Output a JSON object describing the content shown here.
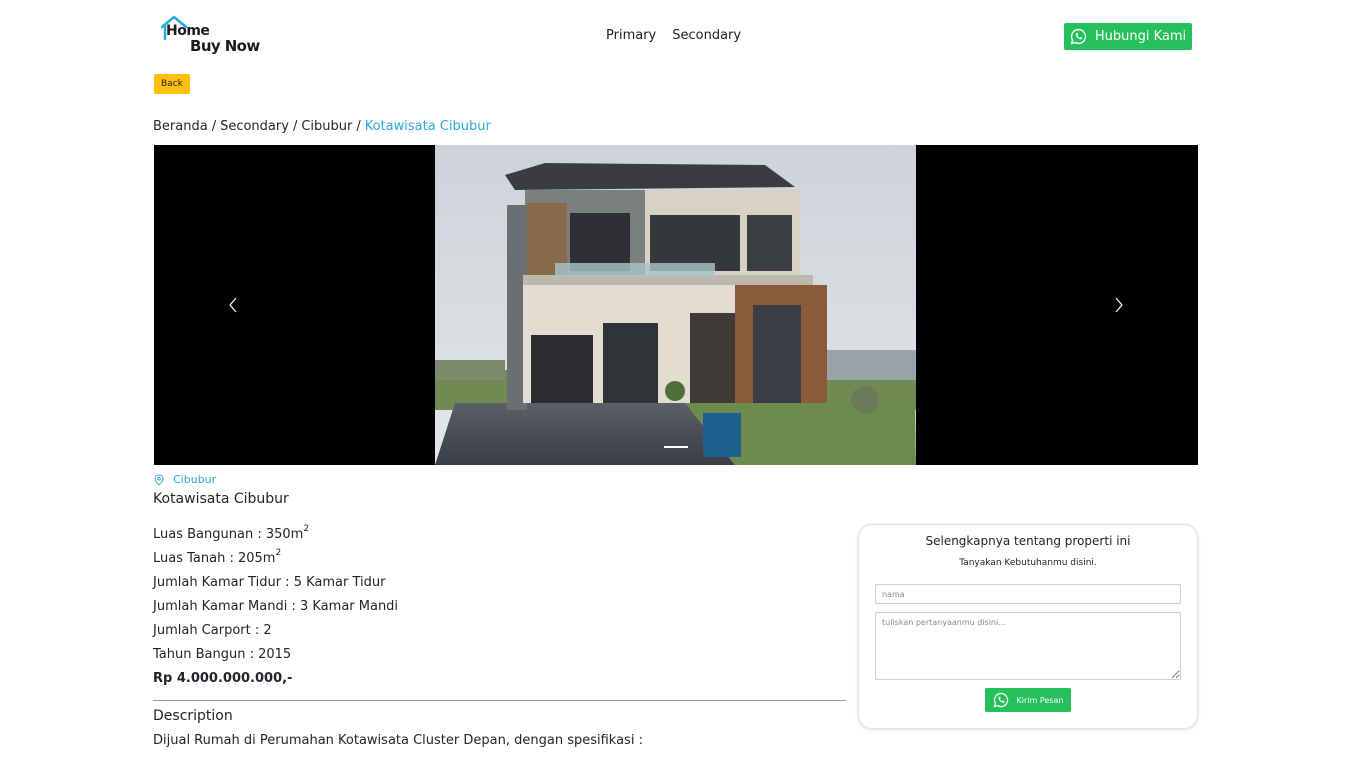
{
  "logo": {
    "line1": "Home",
    "line2": "Buy Now"
  },
  "nav": {
    "items": [
      "Primary",
      "Secondary"
    ]
  },
  "header": {
    "contact_button": "Hubungi Kami"
  },
  "back_button": "Back",
  "breadcrumb": {
    "items": [
      "Beranda",
      "Secondary",
      "Cibubur"
    ],
    "current": "Kotawisata Cibubur",
    "separator": "/"
  },
  "carousel": {
    "slide_count": 1,
    "active_slide": 1
  },
  "property": {
    "location": "Cibubur",
    "title": "Kotawisata Cibubur",
    "specs": [
      {
        "label": "Luas Bangunan : 350m",
        "sup": "2"
      },
      {
        "label": "Luas Tanah : 205m",
        "sup": "2"
      },
      {
        "label": "Jumlah Kamar Tidur : 5 Kamar Tidur",
        "sup": ""
      },
      {
        "label": "Jumlah Kamar Mandi : 3 Kamar Mandi",
        "sup": ""
      },
      {
        "label": "Jumlah Carport : 2",
        "sup": ""
      },
      {
        "label": "Tahun Bangun : 2015",
        "sup": ""
      }
    ],
    "price": "Rp 4.000.000.000,-",
    "description_heading": "Description",
    "description_text": "Dijual Rumah di Perumahan Kotawisata Cluster Depan, dengan spesifikasi :"
  },
  "inquiry": {
    "title": "Selengkapnya tentang properti ini",
    "subtitle": "Tanyakan Kebutuhanmu disini.",
    "name_placeholder": "nama",
    "question_placeholder": "tuliskan pertanyaanmu disini...",
    "send_button": "Kirim Pesan"
  },
  "colors": {
    "whatsapp_green": "#25c05c",
    "back_yellow": "#ffc107",
    "link_blue": "#2aa9d6"
  },
  "icons": {
    "whatsapp": "whatsapp-icon",
    "location": "map-pin-icon",
    "prev": "chevron-left-icon",
    "next": "chevron-right-icon"
  }
}
